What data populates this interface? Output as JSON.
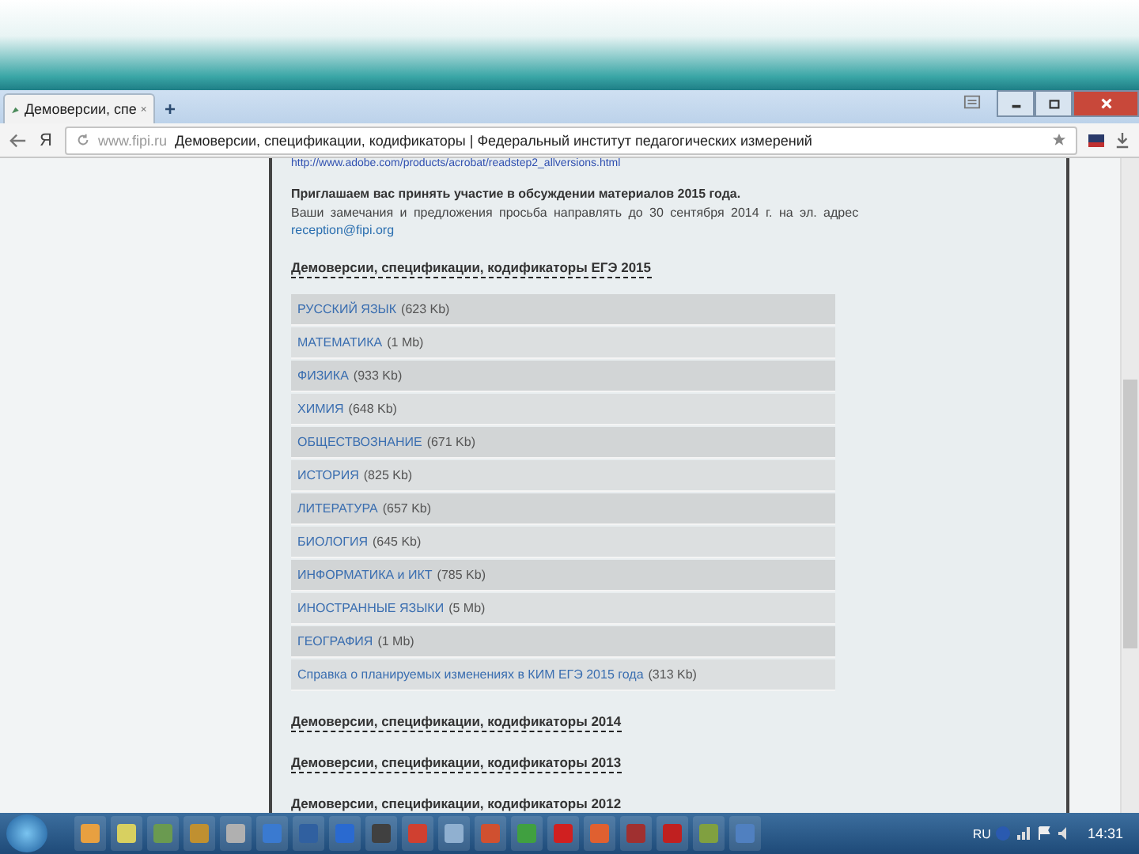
{
  "browser": {
    "tab_title": "Демоверсии, спе",
    "new_tab": "+",
    "yandex_button": "Я",
    "address_host": "www.fipi.ru",
    "address_title": "Демоверсии, спецификации, кодификаторы | Федеральный институт педагогических измерений"
  },
  "page": {
    "link_url": "http://www.adobe.com/products/acrobat/readstep2_allversions.html",
    "invite": "Приглашаем вас принять участие в обсуждении материалов 2015 года.",
    "note": "Ваши замечания и предложения просьба направлять до 30 сентября 2014 г. на эл. адрес",
    "email": "reception@fipi.org",
    "sections": [
      {
        "title": "Демоверсии, спецификации, кодификаторы ЕГЭ 2015",
        "items": [
          {
            "name": "РУССКИЙ ЯЗЫК",
            "size": "(623 Kb)"
          },
          {
            "name": "МАТЕМАТИКА",
            "size": "(1 Mb)"
          },
          {
            "name": "ФИЗИКА",
            "size": "(933 Kb)"
          },
          {
            "name": "ХИМИЯ",
            "size": "(648 Kb)"
          },
          {
            "name": "ОБЩЕСТВОЗНАНИЕ",
            "size": "(671 Kb)"
          },
          {
            "name": "ИСТОРИЯ",
            "size": "(825 Kb)"
          },
          {
            "name": "ЛИТЕРАТУРА",
            "size": "(657 Kb)"
          },
          {
            "name": "БИОЛОГИЯ",
            "size": "(645 Kb)"
          },
          {
            "name": "ИНФОРМАТИКА и ИКТ",
            "size": "(785 Kb)"
          },
          {
            "name": "ИНОСТРАННЫЕ ЯЗЫКИ",
            "size": "(5 Mb)"
          },
          {
            "name": "ГЕОГРАФИЯ",
            "size": "(1 Mb)"
          },
          {
            "name": "Справка о планируемых изменениях в КИМ ЕГЭ 2015 года",
            "size": "(313 Kb)"
          }
        ]
      },
      {
        "title": "Демоверсии, спецификации, кодификаторы 2014"
      },
      {
        "title": "Демоверсии, спецификации, кодификаторы 2013"
      },
      {
        "title": "Демоверсии, спецификации, кодификаторы 2012"
      }
    ]
  },
  "taskbar": {
    "language": "RU",
    "clock": "14:31"
  }
}
